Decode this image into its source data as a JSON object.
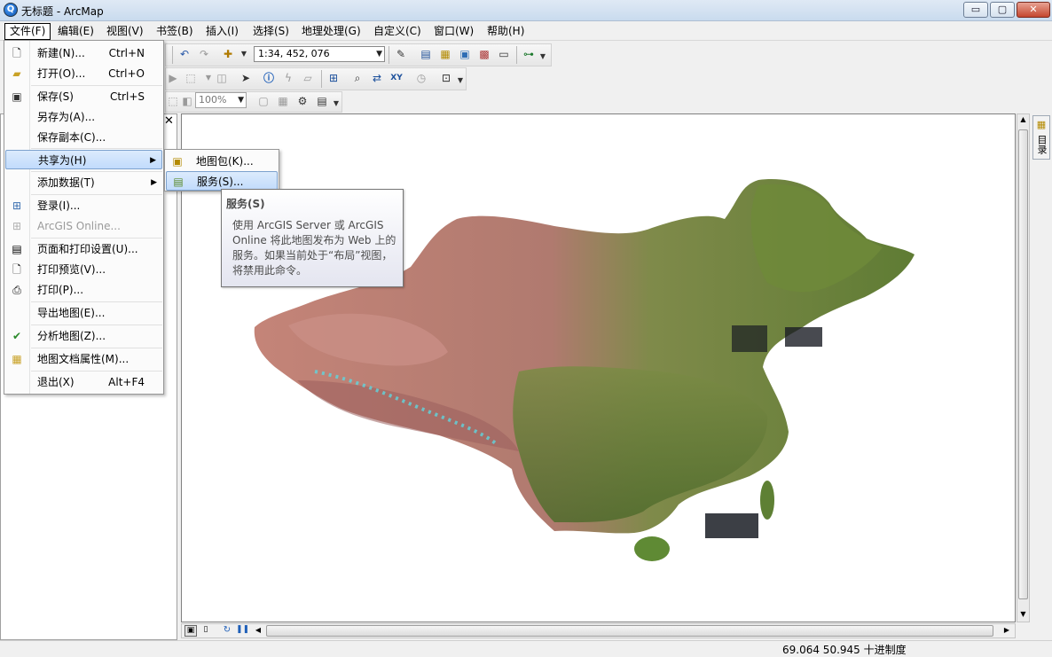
{
  "window": {
    "title": "无标题 - ArcMap",
    "app_icon": "arcmap-globe-icon",
    "controls": {
      "minimize": "▭",
      "maximize": "▢",
      "close": "✕"
    }
  },
  "menubar": [
    "文件(F)",
    "编辑(E)",
    "视图(V)",
    "书签(B)",
    "插入(I)",
    "选择(S)",
    "地理处理(G)",
    "自定义(C)",
    "窗口(W)",
    "帮助(H)"
  ],
  "toolbar": {
    "scale_value": "1:34, 452, 076",
    "zoom_value": "100%"
  },
  "file_menu": {
    "items": [
      {
        "label": "新建(N)...",
        "shortcut": "Ctrl+N",
        "icon": "new-document-icon"
      },
      {
        "label": "打开(O)...",
        "shortcut": "Ctrl+O",
        "icon": "open-folder-icon"
      },
      {
        "label": "保存(S)",
        "shortcut": "Ctrl+S",
        "icon": "save-disk-icon"
      },
      {
        "label": "另存为(A)...",
        "shortcut": "",
        "icon": ""
      },
      {
        "label": "保存副本(C)...",
        "shortcut": "",
        "icon": ""
      },
      {
        "label": "共享为(H)",
        "shortcut": "",
        "icon": "",
        "submenu": true
      },
      {
        "label": "添加数据(T)",
        "shortcut": "",
        "icon": "",
        "submenu": true
      },
      {
        "label": "登录(I)...",
        "shortcut": "",
        "icon": "sign-in-icon"
      },
      {
        "label": "ArcGIS Online...",
        "shortcut": "",
        "icon": "arcgis-online-icon",
        "disabled": true
      },
      {
        "label": "页面和打印设置(U)...",
        "shortcut": "",
        "icon": "page-setup-icon"
      },
      {
        "label": "打印预览(V)...",
        "shortcut": "",
        "icon": "print-preview-icon"
      },
      {
        "label": "打印(P)...",
        "shortcut": "",
        "icon": "printer-icon"
      },
      {
        "label": "导出地图(E)...",
        "shortcut": "",
        "icon": ""
      },
      {
        "label": "分析地图(Z)...",
        "shortcut": "",
        "icon": "analyze-check-icon"
      },
      {
        "label": "地图文档属性(M)...",
        "shortcut": "",
        "icon": "document-properties-icon"
      },
      {
        "label": "退出(X)",
        "shortcut": "Alt+F4",
        "icon": ""
      }
    ]
  },
  "share_menu": {
    "items": [
      {
        "label": "地图包(K)...",
        "icon": "map-package-icon"
      },
      {
        "label": "服务(S)...",
        "icon": "service-icon"
      }
    ]
  },
  "tooltip": {
    "title": "服务(S)",
    "body": "使用 ArcGIS Server 或 ArcGIS Online 将此地图发布为 Web 上的服务。如果当前处于“布局”视图，将禁用此命令。"
  },
  "catalog_tab": {
    "label": "目录"
  },
  "statusbar": {
    "coordinates": "69.064  50.945 十进制度"
  },
  "colors": {
    "menu_highlight": "#c1dbfc",
    "titlebar": "#dfe9f5"
  }
}
